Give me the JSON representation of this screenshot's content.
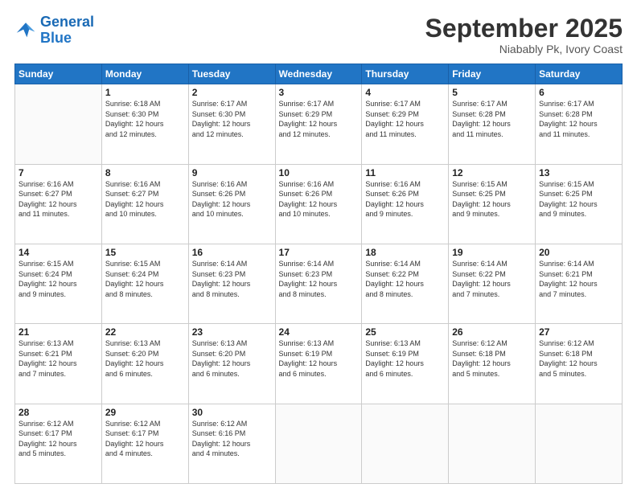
{
  "header": {
    "logo_general": "General",
    "logo_blue": "Blue",
    "month": "September 2025",
    "location": "Niabably Pk, Ivory Coast"
  },
  "weekdays": [
    "Sunday",
    "Monday",
    "Tuesday",
    "Wednesday",
    "Thursday",
    "Friday",
    "Saturday"
  ],
  "weeks": [
    [
      {
        "day": "",
        "info": ""
      },
      {
        "day": "1",
        "info": "Sunrise: 6:18 AM\nSunset: 6:30 PM\nDaylight: 12 hours\nand 12 minutes."
      },
      {
        "day": "2",
        "info": "Sunrise: 6:17 AM\nSunset: 6:30 PM\nDaylight: 12 hours\nand 12 minutes."
      },
      {
        "day": "3",
        "info": "Sunrise: 6:17 AM\nSunset: 6:29 PM\nDaylight: 12 hours\nand 12 minutes."
      },
      {
        "day": "4",
        "info": "Sunrise: 6:17 AM\nSunset: 6:29 PM\nDaylight: 12 hours\nand 11 minutes."
      },
      {
        "day": "5",
        "info": "Sunrise: 6:17 AM\nSunset: 6:28 PM\nDaylight: 12 hours\nand 11 minutes."
      },
      {
        "day": "6",
        "info": "Sunrise: 6:17 AM\nSunset: 6:28 PM\nDaylight: 12 hours\nand 11 minutes."
      }
    ],
    [
      {
        "day": "7",
        "info": "Sunrise: 6:16 AM\nSunset: 6:27 PM\nDaylight: 12 hours\nand 11 minutes."
      },
      {
        "day": "8",
        "info": "Sunrise: 6:16 AM\nSunset: 6:27 PM\nDaylight: 12 hours\nand 10 minutes."
      },
      {
        "day": "9",
        "info": "Sunrise: 6:16 AM\nSunset: 6:26 PM\nDaylight: 12 hours\nand 10 minutes."
      },
      {
        "day": "10",
        "info": "Sunrise: 6:16 AM\nSunset: 6:26 PM\nDaylight: 12 hours\nand 10 minutes."
      },
      {
        "day": "11",
        "info": "Sunrise: 6:16 AM\nSunset: 6:26 PM\nDaylight: 12 hours\nand 9 minutes."
      },
      {
        "day": "12",
        "info": "Sunrise: 6:15 AM\nSunset: 6:25 PM\nDaylight: 12 hours\nand 9 minutes."
      },
      {
        "day": "13",
        "info": "Sunrise: 6:15 AM\nSunset: 6:25 PM\nDaylight: 12 hours\nand 9 minutes."
      }
    ],
    [
      {
        "day": "14",
        "info": "Sunrise: 6:15 AM\nSunset: 6:24 PM\nDaylight: 12 hours\nand 9 minutes."
      },
      {
        "day": "15",
        "info": "Sunrise: 6:15 AM\nSunset: 6:24 PM\nDaylight: 12 hours\nand 8 minutes."
      },
      {
        "day": "16",
        "info": "Sunrise: 6:14 AM\nSunset: 6:23 PM\nDaylight: 12 hours\nand 8 minutes."
      },
      {
        "day": "17",
        "info": "Sunrise: 6:14 AM\nSunset: 6:23 PM\nDaylight: 12 hours\nand 8 minutes."
      },
      {
        "day": "18",
        "info": "Sunrise: 6:14 AM\nSunset: 6:22 PM\nDaylight: 12 hours\nand 8 minutes."
      },
      {
        "day": "19",
        "info": "Sunrise: 6:14 AM\nSunset: 6:22 PM\nDaylight: 12 hours\nand 7 minutes."
      },
      {
        "day": "20",
        "info": "Sunrise: 6:14 AM\nSunset: 6:21 PM\nDaylight: 12 hours\nand 7 minutes."
      }
    ],
    [
      {
        "day": "21",
        "info": "Sunrise: 6:13 AM\nSunset: 6:21 PM\nDaylight: 12 hours\nand 7 minutes."
      },
      {
        "day": "22",
        "info": "Sunrise: 6:13 AM\nSunset: 6:20 PM\nDaylight: 12 hours\nand 6 minutes."
      },
      {
        "day": "23",
        "info": "Sunrise: 6:13 AM\nSunset: 6:20 PM\nDaylight: 12 hours\nand 6 minutes."
      },
      {
        "day": "24",
        "info": "Sunrise: 6:13 AM\nSunset: 6:19 PM\nDaylight: 12 hours\nand 6 minutes."
      },
      {
        "day": "25",
        "info": "Sunrise: 6:13 AM\nSunset: 6:19 PM\nDaylight: 12 hours\nand 6 minutes."
      },
      {
        "day": "26",
        "info": "Sunrise: 6:12 AM\nSunset: 6:18 PM\nDaylight: 12 hours\nand 5 minutes."
      },
      {
        "day": "27",
        "info": "Sunrise: 6:12 AM\nSunset: 6:18 PM\nDaylight: 12 hours\nand 5 minutes."
      }
    ],
    [
      {
        "day": "28",
        "info": "Sunrise: 6:12 AM\nSunset: 6:17 PM\nDaylight: 12 hours\nand 5 minutes."
      },
      {
        "day": "29",
        "info": "Sunrise: 6:12 AM\nSunset: 6:17 PM\nDaylight: 12 hours\nand 4 minutes."
      },
      {
        "day": "30",
        "info": "Sunrise: 6:12 AM\nSunset: 6:16 PM\nDaylight: 12 hours\nand 4 minutes."
      },
      {
        "day": "",
        "info": ""
      },
      {
        "day": "",
        "info": ""
      },
      {
        "day": "",
        "info": ""
      },
      {
        "day": "",
        "info": ""
      }
    ]
  ]
}
